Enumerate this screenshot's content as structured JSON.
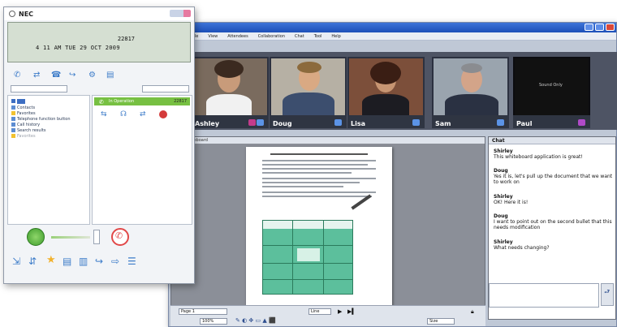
{
  "phone_app": {
    "title": "NEC",
    "lcd_line1": "22817",
    "lcd_line2": "4 11 AM TUE 29 OCT 2009",
    "directory_items": [
      {
        "label": "Contacts"
      },
      {
        "label": "Favorites"
      },
      {
        "label": "Telephone function button"
      },
      {
        "label": "Call history"
      },
      {
        "label": "Search results"
      },
      {
        "label": "Favorites"
      }
    ],
    "call_status": "In Operation",
    "call_number": "22817"
  },
  "collab_app": {
    "menu": [
      "File",
      "View",
      "Attendees",
      "Collaboration",
      "Chat",
      "Tool",
      "Help"
    ],
    "video_tiles": [
      {
        "name": "Ashley",
        "label": "Ashley"
      },
      {
        "name": "Doug",
        "label": "Doug"
      },
      {
        "name": "Lisa",
        "label": "Lisa"
      },
      {
        "name": "Sam",
        "label": "Sam"
      },
      {
        "name": "Paul",
        "label": "Paul",
        "placeholder": "Sound Only"
      }
    ],
    "whiteboard_title": "Whiteboard",
    "whiteboard_footer": {
      "page": "Page 1",
      "zoom": "100%",
      "zoom2": "Line",
      "page_count": "Size"
    },
    "chat": {
      "title": "Chat",
      "messages": [
        {
          "sender": "Shirley",
          "text": "This whiteboard application is great!"
        },
        {
          "sender": "Doug",
          "text": "Yes it is, let's pull up the document that we want to work on"
        },
        {
          "sender": "Shirley",
          "text": "OK! Here it is!"
        },
        {
          "sender": "Doug",
          "text": "I want to point out on the second bullet that this needs modification"
        },
        {
          "sender": "Shirley",
          "text": "What needs changing?"
        }
      ]
    }
  }
}
